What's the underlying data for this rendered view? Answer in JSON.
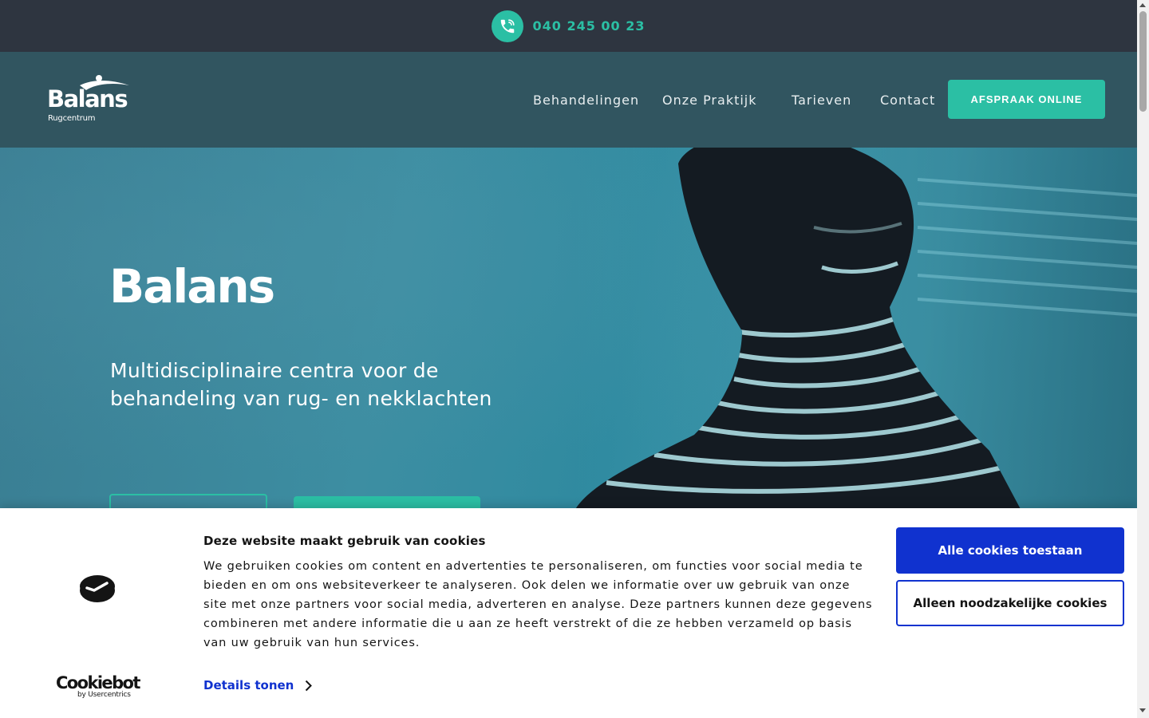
{
  "topbar": {
    "phone": "040 245 00 23",
    "phone_icon": "phone-ringing-icon"
  },
  "header": {
    "logo": {
      "name": "Balans",
      "tagline": "Rugcentrum"
    },
    "nav": [
      "Behandelingen",
      "Onze Praktijk",
      "Tarieven",
      "Contact"
    ],
    "cta": "AFSPRAAK ONLINE"
  },
  "hero": {
    "title": "Balans",
    "subtitle": "Multidisciplinaire centra voor de behandeling van rug- en nekklachten"
  },
  "cookie_banner": {
    "brand": "Cookiebot",
    "brand_sub": "by Usercentrics",
    "title": "Deze website maakt gebruik van cookies",
    "body": "We gebruiken cookies om content en advertenties te personaliseren, om functies voor social media te bieden en om ons websiteverkeer te analyseren. Ook delen we informatie over uw gebruik van onze site met onze partners voor social media, adverteren en analyse. Deze partners kunnen deze gegevens combineren met andere informatie die u aan ze heeft verstrekt of die ze hebben verzameld op basis van uw gebruik van hun services.",
    "details_link": "Details tonen",
    "allow_all": "Alle cookies toestaan",
    "necessary_only": "Alleen noodzakelijke cookies"
  },
  "colors": {
    "topbar_bg": "#2e3540",
    "header_bg": "#315560",
    "accent": "#2bbfa4",
    "cookie_primary": "#1032cf"
  }
}
